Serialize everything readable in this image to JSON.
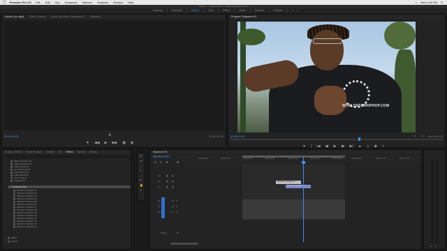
{
  "menubar": {
    "app_name": "Premiere Pro CC",
    "items": [
      "File",
      "Edit",
      "Clip",
      "Sequence",
      "Markers",
      "Graphics",
      "Window",
      "Help"
    ],
    "clock": "Wed 4:50 PM"
  },
  "window_title": "/Users/... — Sequence 01 — Adobe Premiere Pro CC",
  "workspaces": [
    "Learning",
    "Assembly",
    "Editing",
    "Color",
    "Effects",
    "Audio",
    "Graphics",
    "Libraries"
  ],
  "active_workspace": "Editing",
  "source_panel": {
    "tabs": [
      "Source: (no clips)",
      "Effect Controls",
      "Audio Clip Mixer: Sequence 01",
      "Metadata"
    ],
    "timecode_left": "00;00;00;00",
    "timecode_right": "00;00;00;00"
  },
  "program_panel": {
    "tab": "Program: Sequence 01",
    "timecode_left": "00;00;37;07",
    "fit": "Fit",
    "quality": "Full",
    "timecode_right": "00;00;00;15",
    "watermark": "WORLDSTARHIPHOP.COM"
  },
  "project_panel": {
    "tabs": [
      "Project: Untitled",
      "Media Browser",
      "Libraries",
      "Info",
      "Effects",
      "Markers",
      "History"
    ],
    "items": [
      "Video Transitions 01",
      "Audio Transitions 02",
      "Video Presets 03",
      "Lumetri Presets 04",
      "Video Effects 05",
      "Audio Effects 06",
      "Color Looks 07",
      "Favorites 08",
      "Transitions Pack",
      "Distortion Transition 01",
      "Distortion Transition 02",
      "Distortion Transition 03",
      "Distortion Transition 04",
      "Distortion Transition 05",
      "Distortion Transition 06",
      "Distortion Transition 07",
      "Distortion Transition 08",
      "Distortion Transition 09",
      "Distortion Transition 10",
      "Distortion Transition 11",
      "Distortion Transition 12",
      "Distortion Transition 13",
      "Distortion Transition 14"
    ],
    "footer_items": [
      "Effects",
      "Presets"
    ]
  },
  "timeline": {
    "tab": "Sequence 01",
    "timecode": "00;00;37;07",
    "ruler": [
      "00;00;00;00",
      "00;00;08;00",
      "00;00;16;00",
      "00;00;24;00",
      "00;00;32;00",
      "00;00;40;00",
      "00;00;48;00",
      "00;00;56;00",
      "00;01;04;00",
      "00;01;12;00"
    ],
    "video_tracks": [
      "V3",
      "V2",
      "V1"
    ],
    "audio_tracks": [
      "A1",
      "A2",
      "A3"
    ],
    "clip_v2": "Distortion Transition 01",
    "clip_v1": "Distortion Transition 02",
    "master_label": "Master",
    "master_value": "0.0"
  }
}
